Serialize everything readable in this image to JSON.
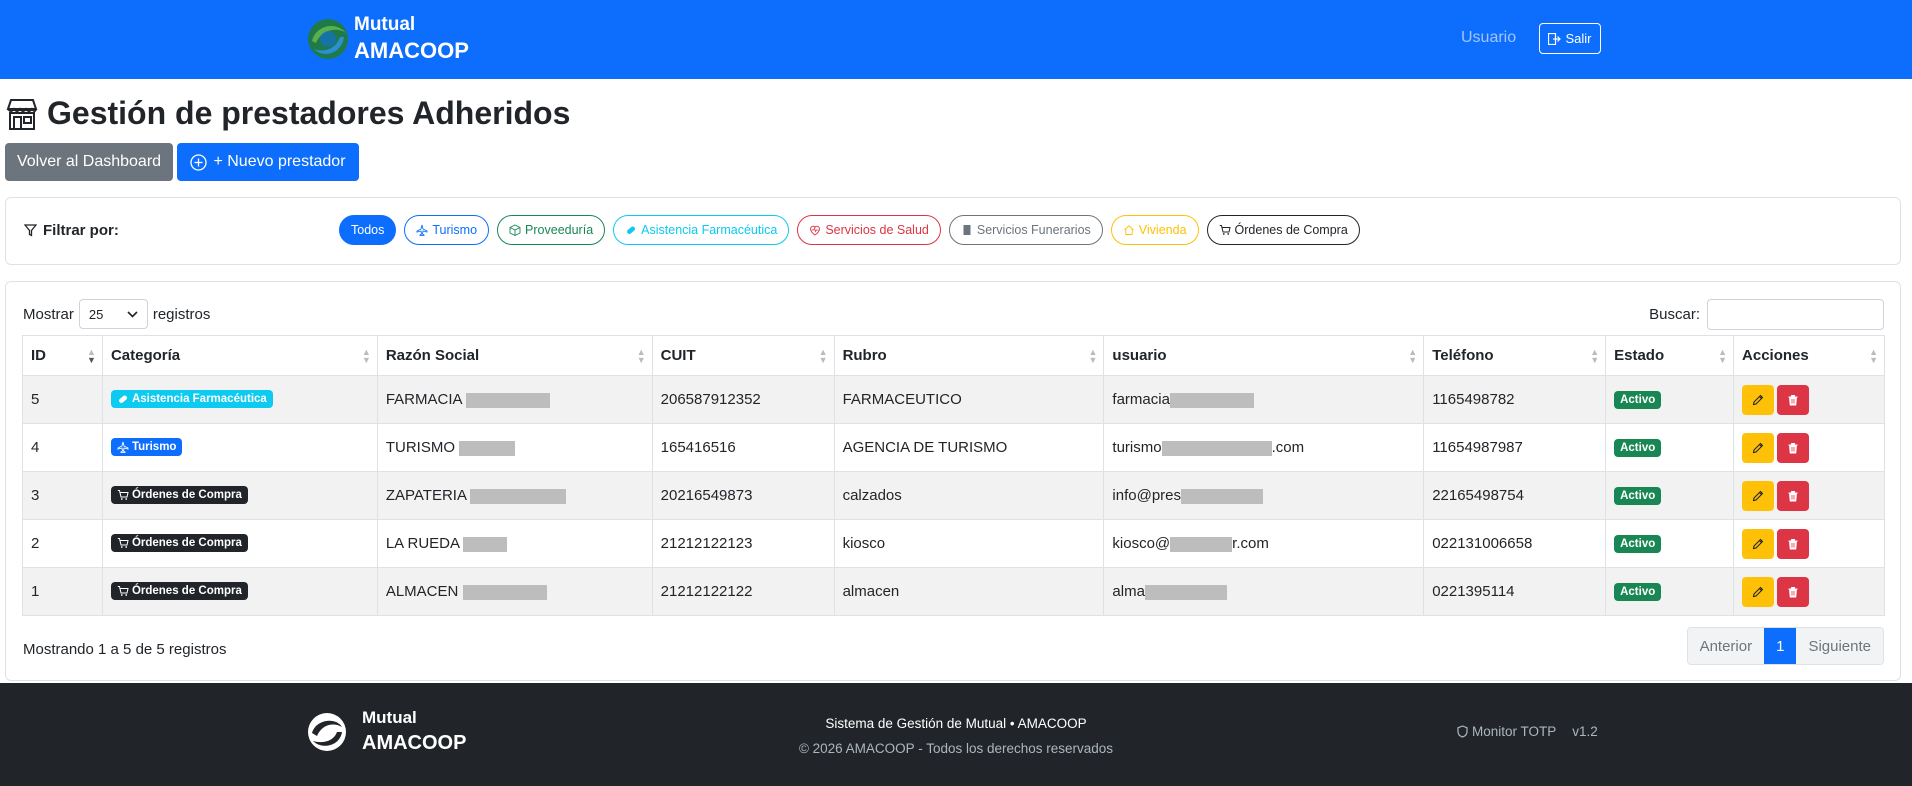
{
  "header": {
    "brand_line1": "Mutual",
    "brand_line2": "AMACOOP",
    "user_label": "Usuario",
    "logout_label": "Salir"
  },
  "page": {
    "title": "Gestión de prestadores Adheridos",
    "back_button": "Volver al Dashboard",
    "new_button": "+ Nuevo prestador"
  },
  "filter": {
    "label": "Filtrar por:",
    "chips": [
      {
        "label": "Todos",
        "color": "#0d6efd",
        "active": true
      },
      {
        "label": "Turismo",
        "color": "#0d6efd",
        "icon": "plane-icon"
      },
      {
        "label": "Proveeduría",
        "color": "#198754",
        "icon": "box-icon"
      },
      {
        "label": "Asistencia Farmacéutica",
        "color": "#0dcaf0",
        "icon": "capsule-icon"
      },
      {
        "label": "Servicios de Salud",
        "color": "#dc3545",
        "icon": "heart-pulse-icon"
      },
      {
        "label": "Servicios Funerarios",
        "color": "#6c757d",
        "icon": "square-icon"
      },
      {
        "label": "Vivienda",
        "color": "#ffc107",
        "icon": "house-icon"
      },
      {
        "label": "Órdenes de Compra",
        "color": "#212529",
        "icon": "cart-icon"
      }
    ]
  },
  "table": {
    "show_label": "Mostrar",
    "page_size": "25",
    "records_label": "registros",
    "search_label": "Buscar:",
    "columns": [
      "ID",
      "Categoría",
      "Razón Social",
      "CUIT",
      "Rubro",
      "usuario",
      "Teléfono",
      "Estado",
      "Acciones"
    ],
    "rows": [
      {
        "id": "5",
        "categoria": "Asistencia Farmacéutica",
        "cat_class": "b-farm",
        "cat_icon": "capsule-icon",
        "razon": "FARMACIA",
        "cuit": "206587912352",
        "rubro": "FARMACEUTICO",
        "usuario_pre": "farmacia",
        "usuario_post": "",
        "telefono": "1165498782",
        "estado": "Activo"
      },
      {
        "id": "4",
        "categoria": "Turismo",
        "cat_class": "b-tur",
        "cat_icon": "plane-icon",
        "razon": "TURISMO",
        "cuit": "165416516",
        "rubro": "AGENCIA DE TURISMO",
        "usuario_pre": "turismo",
        "usuario_post": ".com",
        "telefono": "11654987987",
        "estado": "Activo"
      },
      {
        "id": "3",
        "categoria": "Órdenes de Compra",
        "cat_class": "b-oc",
        "cat_icon": "cart-icon",
        "razon": "ZAPATERIA",
        "cuit": "20216549873",
        "rubro": "calzados",
        "usuario_pre": "info@pres",
        "usuario_post": "",
        "telefono": "22165498754",
        "estado": "Activo"
      },
      {
        "id": "2",
        "categoria": "Órdenes de Compra",
        "cat_class": "b-oc",
        "cat_icon": "cart-icon",
        "razon": "LA RUEDA",
        "cuit": "21212122123",
        "rubro": "kiosco",
        "usuario_pre": "kiosco@",
        "usuario_post": "r.com",
        "telefono": "022131006658",
        "estado": "Activo"
      },
      {
        "id": "1",
        "categoria": "Órdenes de Compra",
        "cat_class": "b-oc",
        "cat_icon": "cart-icon",
        "razon": "ALMACEN",
        "cuit": "21212122122",
        "rubro": "almacen",
        "usuario_pre": "alma",
        "usuario_post": "",
        "telefono": "0221395114",
        "estado": "Activo"
      }
    ],
    "info": "Mostrando 1 a 5 de 5 registros",
    "pager": {
      "prev": "Anterior",
      "current": "1",
      "next": "Siguiente"
    }
  },
  "footer": {
    "brand_line1": "Mutual",
    "brand_line2": "AMACOOP",
    "system": "Sistema de Gestión de Mutual • AMACOOP",
    "copyright": "© 2026 AMACOOP - Todos los derechos reservados",
    "monitor": "Monitor TOTP",
    "version": "v1.2"
  }
}
